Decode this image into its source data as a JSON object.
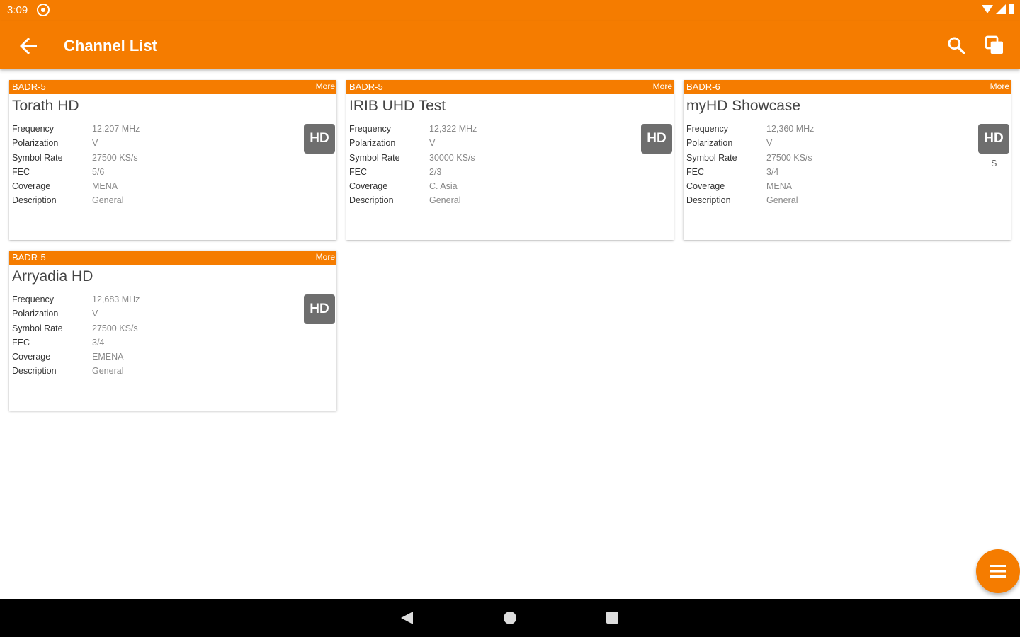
{
  "status_bar": {
    "time": "3:09"
  },
  "app_bar": {
    "title": "Channel List"
  },
  "cards": [
    {
      "satellite": "BADR-5",
      "more": "More",
      "name": "Torath HD",
      "badge": "HD",
      "price_mark": "",
      "details": [
        {
          "label": "Frequency",
          "value": "12,207 MHz"
        },
        {
          "label": "Polarization",
          "value": "V"
        },
        {
          "label": "Symbol Rate",
          "value": "27500 KS/s"
        },
        {
          "label": "FEC",
          "value": "5/6"
        },
        {
          "label": "Coverage",
          "value": "MENA"
        },
        {
          "label": "Description",
          "value": "General"
        }
      ]
    },
    {
      "satellite": "BADR-5",
      "more": "More",
      "name": "IRIB UHD Test",
      "badge": "HD",
      "price_mark": "",
      "details": [
        {
          "label": "Frequency",
          "value": "12,322 MHz"
        },
        {
          "label": "Polarization",
          "value": "V"
        },
        {
          "label": "Symbol Rate",
          "value": "30000 KS/s"
        },
        {
          "label": "FEC",
          "value": "2/3"
        },
        {
          "label": "Coverage",
          "value": "C. Asia"
        },
        {
          "label": "Description",
          "value": "General"
        }
      ]
    },
    {
      "satellite": "BADR-6",
      "more": "More",
      "name": "myHD Showcase",
      "badge": "HD",
      "price_mark": "$",
      "details": [
        {
          "label": "Frequency",
          "value": "12,360 MHz"
        },
        {
          "label": "Polarization",
          "value": "V"
        },
        {
          "label": "Symbol Rate",
          "value": "27500 KS/s"
        },
        {
          "label": "FEC",
          "value": "3/4"
        },
        {
          "label": "Coverage",
          "value": "MENA"
        },
        {
          "label": "Description",
          "value": "General"
        }
      ]
    },
    {
      "satellite": "BADR-5",
      "more": "More",
      "name": "Arryadia HD",
      "badge": "HD",
      "price_mark": "",
      "details": [
        {
          "label": "Frequency",
          "value": "12,683 MHz"
        },
        {
          "label": "Polarization",
          "value": "V"
        },
        {
          "label": "Symbol Rate",
          "value": "27500 KS/s"
        },
        {
          "label": "FEC",
          "value": "3/4"
        },
        {
          "label": "Coverage",
          "value": "EMENA"
        },
        {
          "label": "Description",
          "value": "General"
        }
      ]
    }
  ],
  "colors": {
    "accent": "#f57c00",
    "badge": "#6e6e6e"
  }
}
